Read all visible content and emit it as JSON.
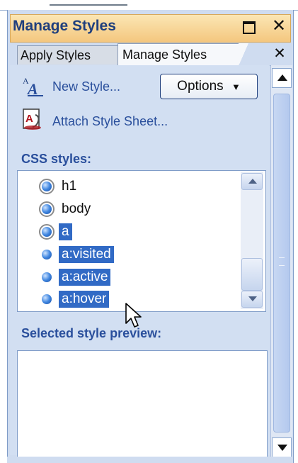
{
  "window": {
    "title": "Manage Styles",
    "maximize_icon": "maximize-icon",
    "close_glyph": "✕"
  },
  "tabs": [
    {
      "label": "Apply Styles",
      "active": false
    },
    {
      "label": "Manage Styles",
      "active": true
    }
  ],
  "tab_close_glyph": "✕",
  "actions": {
    "new_style": "New Style...",
    "options": "Options",
    "options_arrow": "▼",
    "attach": "Attach Style Sheet..."
  },
  "css_styles_label": "CSS styles:",
  "styles": [
    {
      "name": "h1",
      "selected": false,
      "marker": "ring"
    },
    {
      "name": "body",
      "selected": false,
      "marker": "ring"
    },
    {
      "name": "a",
      "selected": true,
      "marker": "ring"
    },
    {
      "name": "a:visited",
      "selected": true,
      "marker": "dot"
    },
    {
      "name": "a:active",
      "selected": true,
      "marker": "dot"
    },
    {
      "name": "a:hover",
      "selected": true,
      "marker": "dot"
    }
  ],
  "preview_label": "Selected style preview:",
  "colors": {
    "accent_blue": "#316ac5",
    "link_text": "#2a4f9c",
    "titlebar": "#f4c77f",
    "panel_bg": "#d2dff2"
  }
}
